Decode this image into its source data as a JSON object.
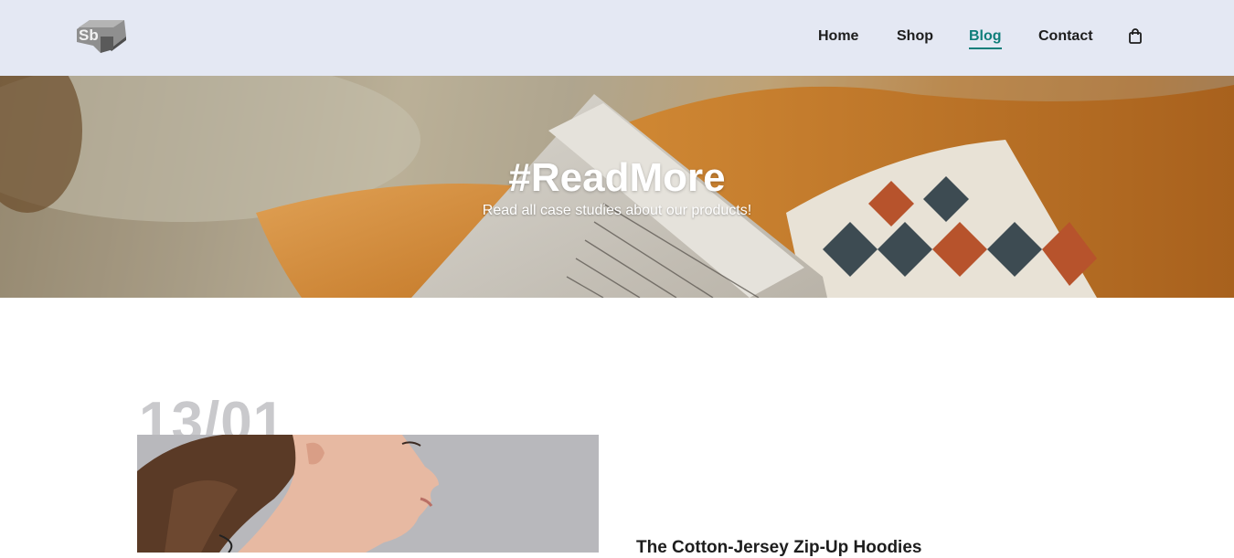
{
  "header": {
    "logo_text": "Sb",
    "nav": {
      "home": "Home",
      "shop": "Shop",
      "blog": "Blog",
      "contact": "Contact"
    },
    "cart_icon": "shopping-bag-icon",
    "active_color": "#0f7e7a"
  },
  "hero": {
    "title": "#ReadMore",
    "subtitle": "Read all case studies about our products!"
  },
  "post": {
    "date": "13/01",
    "title": "The Cotton-Jersey Zip-Up Hoodies"
  }
}
